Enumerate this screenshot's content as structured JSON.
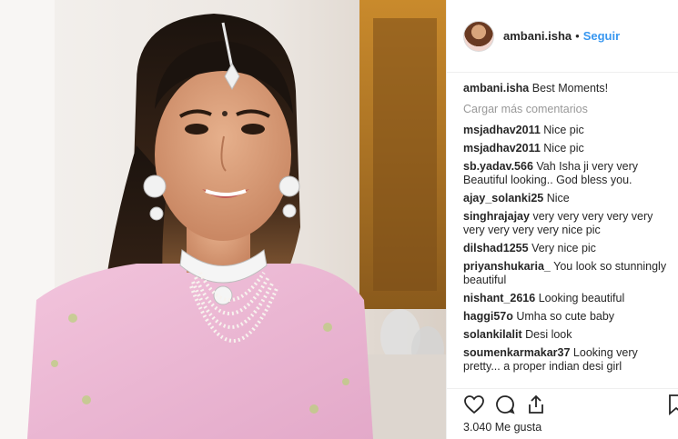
{
  "header": {
    "username": "ambani.isha",
    "separator": "•",
    "follow_label": "Seguir"
  },
  "caption": {
    "username": "ambani.isha",
    "text": "Best Moments!"
  },
  "load_more_label": "Cargar más comentarios",
  "comments": [
    {
      "user": "msjadhav2011",
      "text": "Nice pic"
    },
    {
      "user": "msjadhav2011",
      "text": "Nice pic"
    },
    {
      "user": "sb.yadav.566",
      "text": "Vah Isha ji very very Beautiful looking.. God bless you."
    },
    {
      "user": "ajay_solanki25",
      "text": "Nice"
    },
    {
      "user": "singhrajajay",
      "text": "very very very very very very very very very nice pic"
    },
    {
      "user": "dilshad1255",
      "text": "Very nice pic"
    },
    {
      "user": "priyanshukaria_",
      "text": "You look so stunningly beautiful"
    },
    {
      "user": "nishant_2616",
      "text": "Looking beautiful"
    },
    {
      "user": "haggi57o",
      "text": "Umha so cute baby"
    },
    {
      "user": "solankilalit",
      "text": "Desi look"
    },
    {
      "user": "soumenkarmakar37",
      "text": "Looking very pretty... a proper indian desi girl"
    }
  ],
  "likes_label": "3.040 Me gusta",
  "icons": {
    "like": "heart-icon",
    "comment": "comment-icon",
    "share": "share-icon",
    "save": "bookmark-icon"
  }
}
